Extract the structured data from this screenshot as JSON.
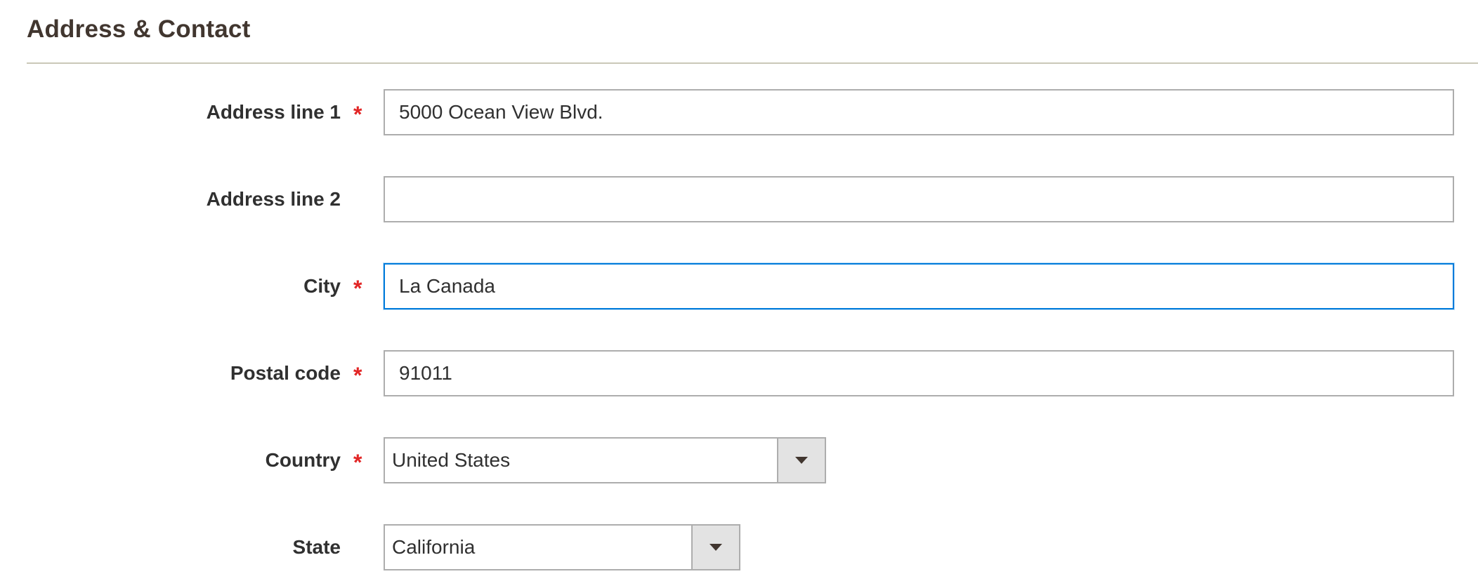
{
  "section": {
    "title": "Address & Contact"
  },
  "fields": {
    "address_line_1": {
      "label": "Address line 1",
      "required_mark": "*",
      "value": "5000 Ocean View Blvd."
    },
    "address_line_2": {
      "label": "Address line 2",
      "value": ""
    },
    "city": {
      "label": "City",
      "required_mark": "*",
      "value": "La Canada",
      "focused": true
    },
    "postal_code": {
      "label": "Postal code",
      "required_mark": "*",
      "value": "91011"
    },
    "country": {
      "label": "Country",
      "required_mark": "*",
      "selected": "United States",
      "dropdown_icon": "chevron-down-icon"
    },
    "state": {
      "label": "State",
      "selected": "California",
      "dropdown_icon": "chevron-down-icon"
    }
  },
  "colors": {
    "required_star": "#e22626",
    "focus_border": "#007bdb",
    "input_border": "#adadad",
    "select_button_bg": "#e3e3e3",
    "section_rule": "#cac8b8"
  }
}
